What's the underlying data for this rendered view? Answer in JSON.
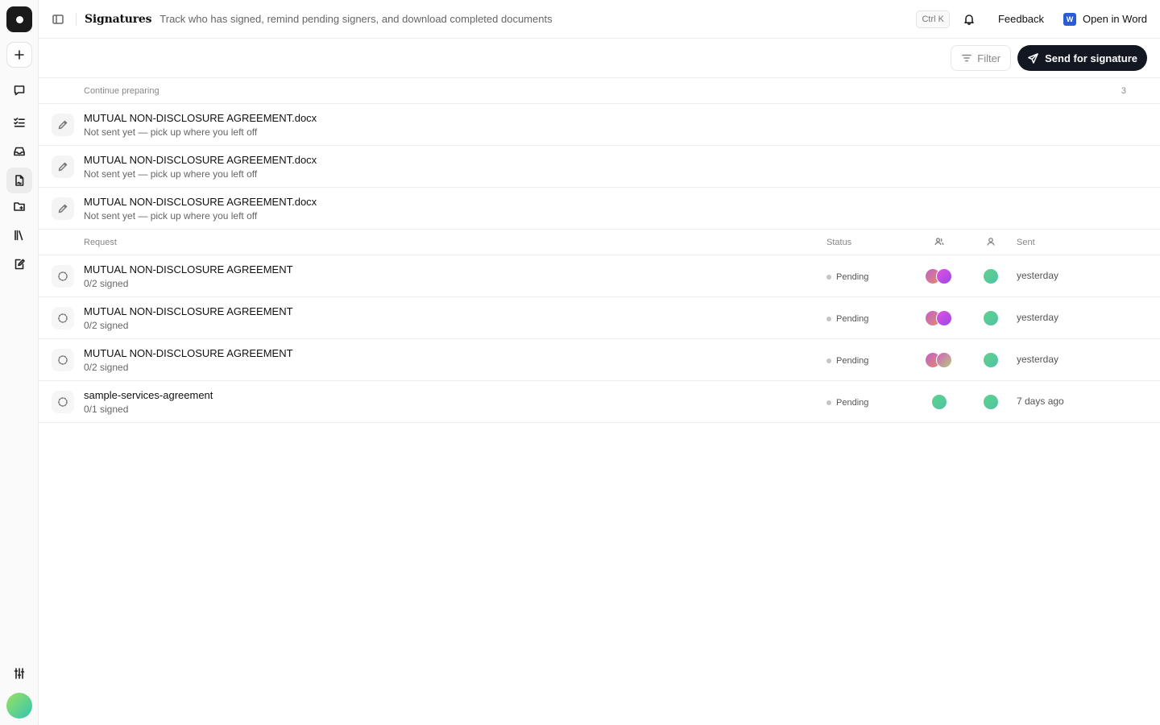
{
  "header": {
    "title": "Signatures",
    "subtitle": "Track who has signed, remind pending signers, and download completed documents",
    "shortcut": "Ctrl K",
    "feedback": "Feedback",
    "open_in_word": "Open in Word"
  },
  "toolbar": {
    "filter_label": "Filter",
    "send_label": "Send for signature"
  },
  "drafts": {
    "heading": "Continue preparing",
    "count": "3",
    "items": [
      {
        "title": "MUTUAL NON-DISCLOSURE AGREEMENT.docx",
        "subtitle": "Not sent yet — pick up where you left off"
      },
      {
        "title": "MUTUAL NON-DISCLOSURE AGREEMENT.docx",
        "subtitle": "Not sent yet — pick up where you left off"
      },
      {
        "title": "MUTUAL NON-DISCLOSURE AGREEMENT.docx",
        "subtitle": "Not sent yet — pick up where you left off"
      }
    ]
  },
  "requests": {
    "columns": {
      "request": "Request",
      "status": "Status",
      "sent": "Sent"
    },
    "rows": [
      {
        "title": "MUTUAL NON-DISCLOSURE AGREEMENT",
        "progress": "0/2 signed",
        "status": "Pending",
        "sent": "yesterday"
      },
      {
        "title": "MUTUAL NON-DISCLOSURE AGREEMENT",
        "progress": "0/2 signed",
        "status": "Pending",
        "sent": "yesterday"
      },
      {
        "title": "MUTUAL NON-DISCLOSURE AGREEMENT",
        "progress": "0/2 signed",
        "status": "Pending",
        "sent": "yesterday"
      },
      {
        "title": "sample-services-agreement",
        "progress": "0/1 signed",
        "status": "Pending",
        "sent": "7 days ago"
      }
    ]
  },
  "colors": {
    "primary_button": "#131722",
    "pending_dot": "#c4c4c4",
    "divider": "#ececec"
  }
}
